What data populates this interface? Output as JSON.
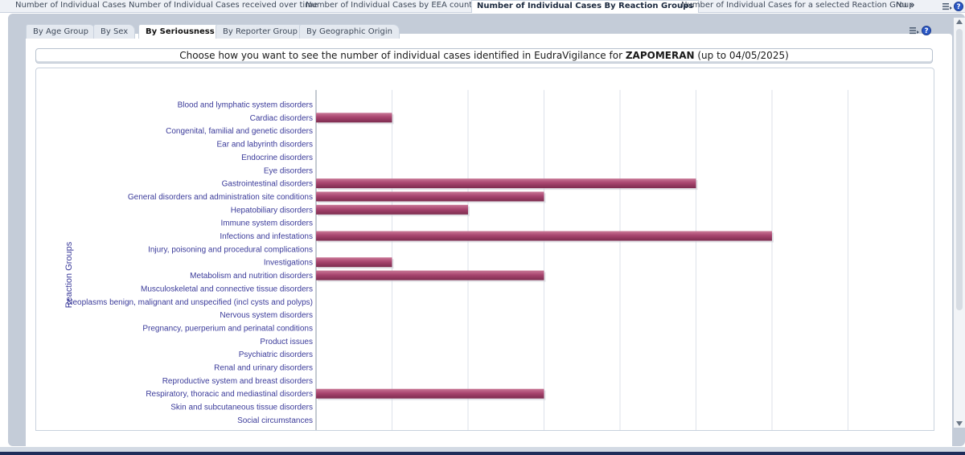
{
  "top_tabs": [
    {
      "label": "Number of Individual Cases",
      "active": false
    },
    {
      "label": "Number of Individual Cases received over time",
      "active": false
    },
    {
      "label": "Number of Individual Cases by EEA countries",
      "active": false
    },
    {
      "label": "Number of Individual Cases By Reaction Groups",
      "active": true
    },
    {
      "label": "Number of Individual Cases for a selected Reaction Group",
      "active": false
    },
    {
      "label": "Nu",
      "active": false
    }
  ],
  "top_overflow_symbol": "»",
  "sub_tabs": [
    {
      "label": "By Age Group",
      "active": false
    },
    {
      "label": "By Sex",
      "active": false
    },
    {
      "label": "By Seriousness",
      "active": true
    },
    {
      "label": "By Reporter Group",
      "active": false
    },
    {
      "label": "By Geographic Origin",
      "active": false
    }
  ],
  "banner": {
    "prefix": "Choose how you want to see the number of individual cases identified in EudraVigilance for ",
    "drug": "ZAPOMERAN",
    "suffix": " (up to 04/05/2025)"
  },
  "help_glyph": "?",
  "colors": {
    "bar": "#a8456f",
    "bar_highlight": "#c97796",
    "grid": "#dde2ea",
    "label": "#3b3b9a"
  },
  "chart_data": {
    "type": "bar",
    "orientation": "horizontal",
    "ylabel": "Reaction Groups",
    "categories": [
      "Blood and lymphatic system disorders",
      "Cardiac disorders",
      "Congenital, familial and genetic disorders",
      "Ear and labyrinth disorders",
      "Endocrine disorders",
      "Eye disorders",
      "Gastrointestinal disorders",
      "General disorders and administration site conditions",
      "Hepatobiliary disorders",
      "Immune system disorders",
      "Infections and infestations",
      "Injury, poisoning and procedural complications",
      "Investigations",
      "Metabolism and nutrition disorders",
      "Musculoskeletal and connective tissue disorders",
      "Neoplasms benign, malignant and unspecified (incl cysts and polyps)",
      "Nervous system disorders",
      "Pregnancy, puerperium and perinatal conditions",
      "Product issues",
      "Psychiatric disorders",
      "Renal and urinary disorders",
      "Reproductive system and breast disorders",
      "Respiratory, thoracic and mediastinal disorders",
      "Skin and subcutaneous tissue disorders",
      "Social circumstances"
    ],
    "values": [
      0,
      1,
      0,
      0,
      0,
      0,
      5,
      3,
      2,
      0,
      6,
      0,
      1,
      3,
      0,
      0,
      0,
      0,
      0,
      0,
      0,
      0,
      3,
      0,
      0
    ],
    "xlim": [
      0,
      7
    ],
    "grid": true,
    "legend": "none"
  }
}
